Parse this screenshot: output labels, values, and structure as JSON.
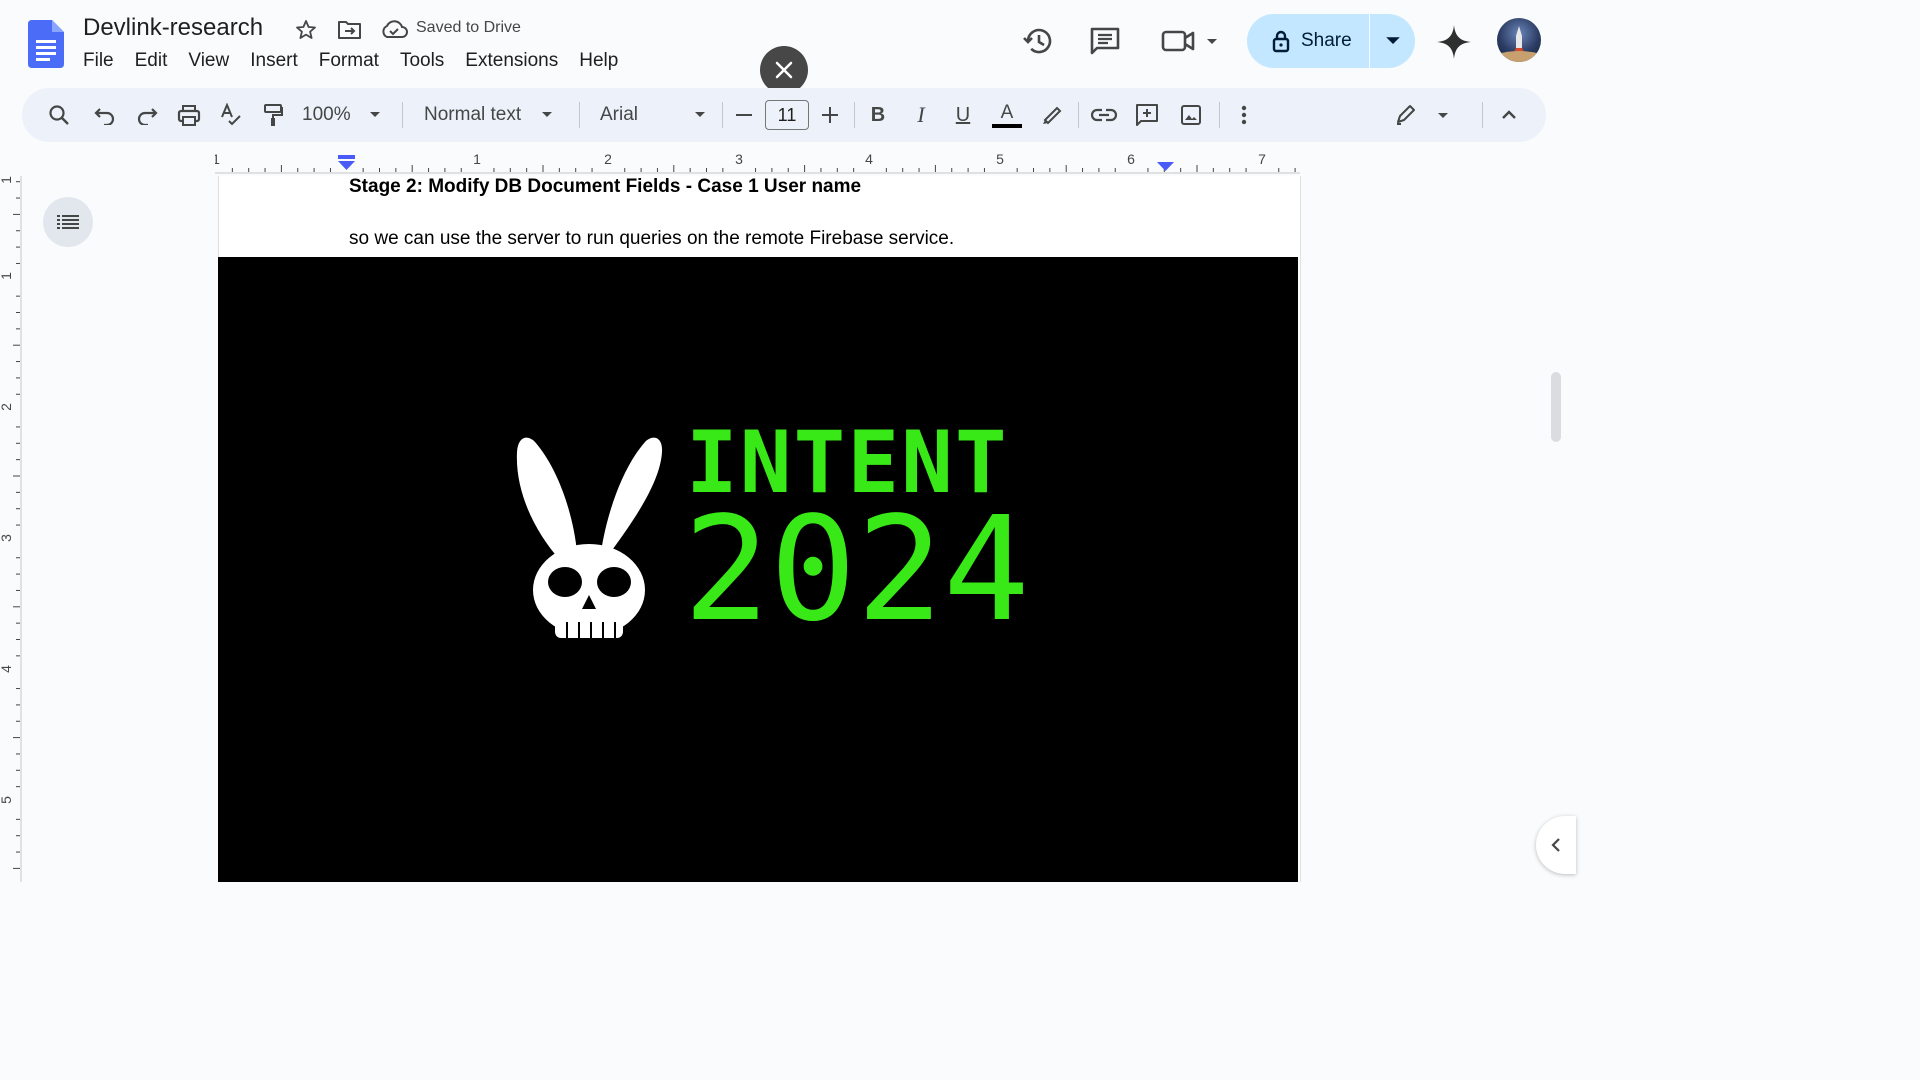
{
  "header": {
    "title": "Devlink-research",
    "save_status": "Saved to Drive",
    "share_label": "Share"
  },
  "menu": [
    "File",
    "Edit",
    "View",
    "Insert",
    "Format",
    "Tools",
    "Extensions",
    "Help"
  ],
  "toolbar": {
    "zoom": "100%",
    "style": "Normal text",
    "font": "Arial",
    "font_size": "11"
  },
  "ruler": {
    "labels": [
      "1",
      "1",
      "2",
      "3",
      "4",
      "5",
      "6",
      "7"
    ],
    "vertical_labels": [
      "1",
      "1",
      "2",
      "3",
      "4",
      "5"
    ]
  },
  "document": {
    "heading": "Stage 2: Modify DB Document Fields - Case 1 User name",
    "paragraph": "so we can use the server to run queries on the remote Firebase service.",
    "image": {
      "title": "INTENT",
      "year": "2024"
    }
  },
  "colors": {
    "accent": "#c2e7ff",
    "banner_green": "#39e817",
    "banner_bg": "#000000",
    "ruler_marker": "#4a5af7"
  },
  "icons": [
    "docs-logo-icon",
    "star-icon",
    "move-folder-icon",
    "cloud-saved-icon",
    "close-icon",
    "history-icon",
    "comments-icon",
    "meet-icon",
    "lock-icon",
    "gemini-icon",
    "search-icon",
    "undo-icon",
    "redo-icon",
    "print-icon",
    "spellcheck-icon",
    "paint-format-icon",
    "bold-icon",
    "italic-icon",
    "underline-icon",
    "text-color-icon",
    "highlight-icon",
    "link-icon",
    "add-comment-icon",
    "insert-image-icon",
    "more-icon",
    "edit-mode-icon",
    "collapse-icon",
    "outline-icon",
    "chevron-left-icon"
  ]
}
